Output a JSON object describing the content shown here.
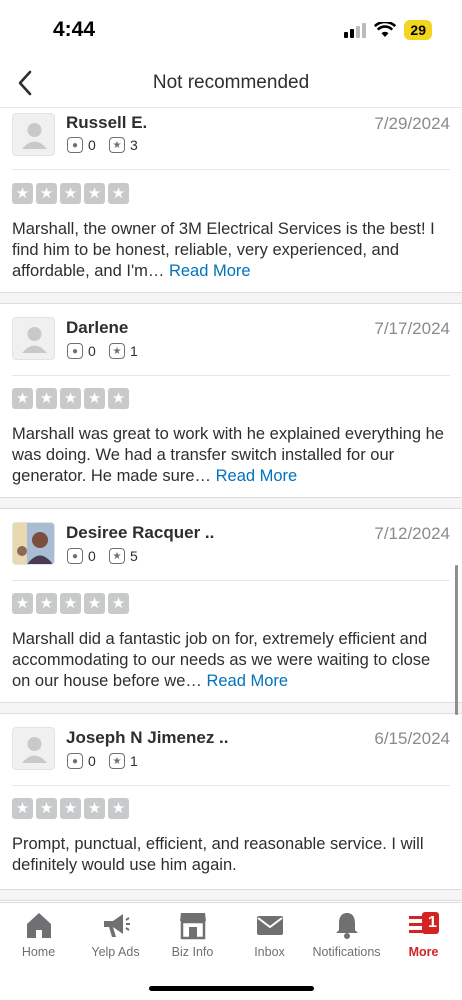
{
  "status_bar": {
    "time": "4:44",
    "battery": "29"
  },
  "header": {
    "title": "Not recommended",
    "back_icon": "chevron-left-icon"
  },
  "reviews": [
    {
      "name": "Russell E.",
      "date": "7/29/2024",
      "friends": "0",
      "reviews": "3",
      "text": "Marshall, the owner of 3M Electrical Services is the best! I find him to be honest, reliable, very experienced, and affordable, and I'm… ",
      "read_more": "Read More",
      "rating": 5
    },
    {
      "name": "Darlene",
      "date": "7/17/2024",
      "friends": "0",
      "reviews": "1",
      "text": "Marshall was great to work with he explained everything he was doing.  We had a transfer switch installed for our generator.  He made sure… ",
      "read_more": "Read More",
      "rating": 5
    },
    {
      "name": "Desiree Racquer ..",
      "date": "7/12/2024",
      "friends": "0",
      "reviews": "5",
      "text": "Marshall did a fantastic job on for, extremely efficient and accommodating to our needs as we were waiting to close on our house before we… ",
      "read_more": "Read More",
      "rating": 5
    },
    {
      "name": "Joseph N Jimenez ..",
      "date": "6/15/2024",
      "friends": "0",
      "reviews": "1",
      "text": "Prompt, punctual, efficient, and reasonable service.  I will definitely would use him again.",
      "read_more": "",
      "rating": 5
    }
  ],
  "tabs": [
    {
      "label": "Home",
      "icon": "home-icon"
    },
    {
      "label": "Yelp Ads",
      "icon": "megaphone-icon"
    },
    {
      "label": "Biz Info",
      "icon": "storefront-icon"
    },
    {
      "label": "Inbox",
      "icon": "envelope-icon"
    },
    {
      "label": "Notifications",
      "icon": "bell-icon"
    },
    {
      "label": "More",
      "icon": "menu-icon",
      "badge": "1",
      "active": true
    }
  ],
  "colors": {
    "accent": "#d32323",
    "link": "#0073bb",
    "star_empty": "#c8c9ca"
  }
}
